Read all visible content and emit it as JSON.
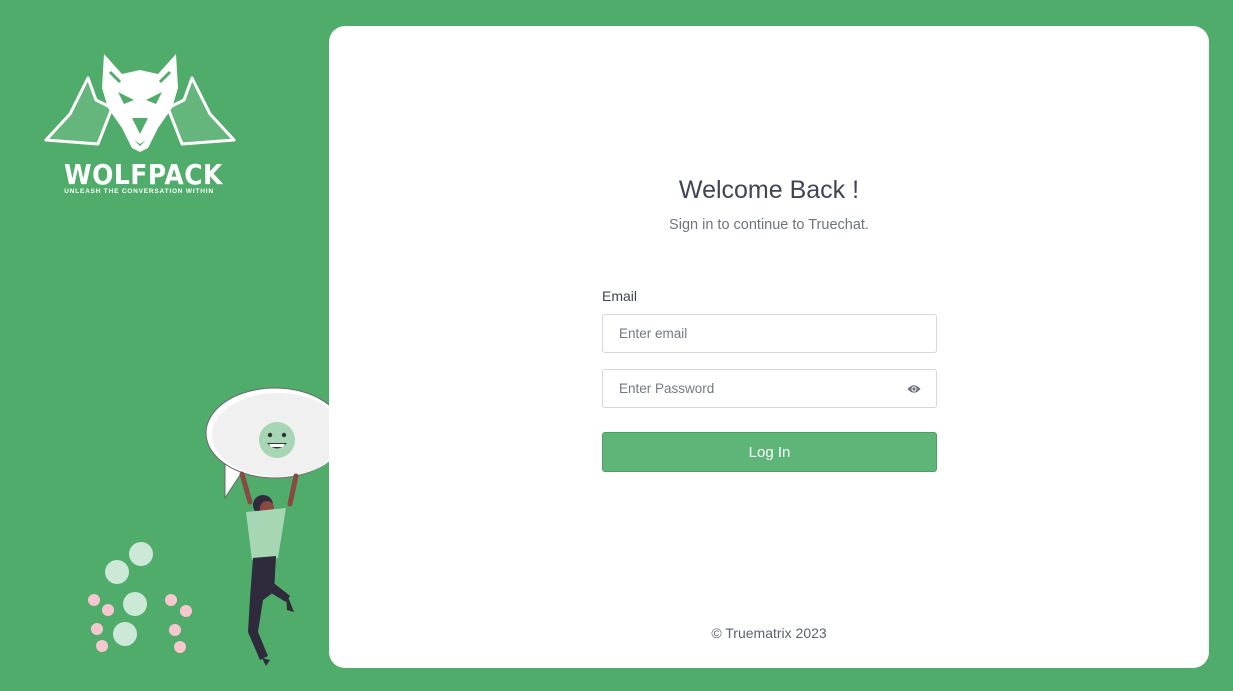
{
  "brand": {
    "name": "WOLFPACK",
    "tagline": "UNLEASH THE CONVERSATION WITHIN"
  },
  "login": {
    "title": "Welcome Back !",
    "subtitle": "Sign in to continue to Truechat.",
    "email_label": "Email",
    "email_placeholder": "Enter email",
    "password_placeholder": "Enter Password",
    "submit_label": "Log In"
  },
  "footer": {
    "text": "© Truematrix 2023"
  },
  "icons": {
    "logo": "wolf-head-icon",
    "password_toggle": "eye-icon",
    "speech": "smiley-icon"
  },
  "colors": {
    "background": "#4fac6a",
    "accent": "#5db577",
    "card": "#ffffff"
  }
}
